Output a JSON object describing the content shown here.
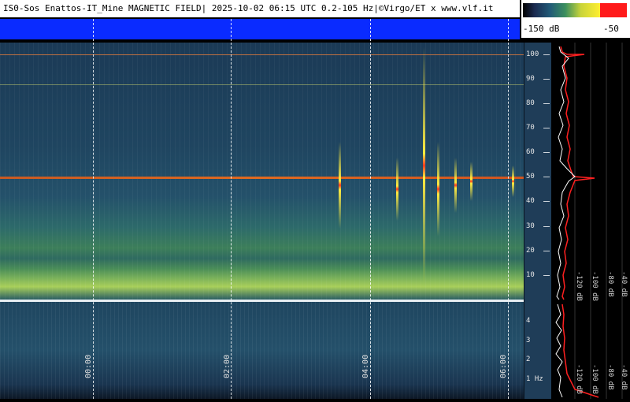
{
  "header": {
    "title": "IS0-Sos Enattos-IT_Mine MAGNETIC FIELD| 2025-10-02 06:15 UTC 0.2-105 Hz|©Virgo/ET x www.vlf.it"
  },
  "color_scale": {
    "min_label": "-150 dB",
    "max_label": "-50"
  },
  "time_axis": {
    "labels": [
      "00:00",
      "02:00",
      "04:00",
      "06:00"
    ]
  },
  "freq_axis_top": {
    "ticks": [
      "100",
      "90",
      "80",
      "70",
      "60",
      "50",
      "40",
      "30",
      "20",
      "10"
    ]
  },
  "freq_axis_bottom": {
    "ticks": [
      "4",
      "3",
      "2",
      "1 Hz"
    ]
  },
  "spectrum_axis_top": {
    "labels": [
      "-120 dB",
      "-100 dB",
      "-80 dB",
      "-40 dB"
    ]
  },
  "spectrum_axis_bottom": {
    "labels": [
      "-120 dB",
      "-100 dB",
      "-80 dB",
      "-40 dB"
    ]
  },
  "colors": {
    "title_band": "#0a2bff",
    "mains_line": "#e06a20",
    "spectrum_red": "#ff2020",
    "spectrum_white": "#ffffff"
  }
}
